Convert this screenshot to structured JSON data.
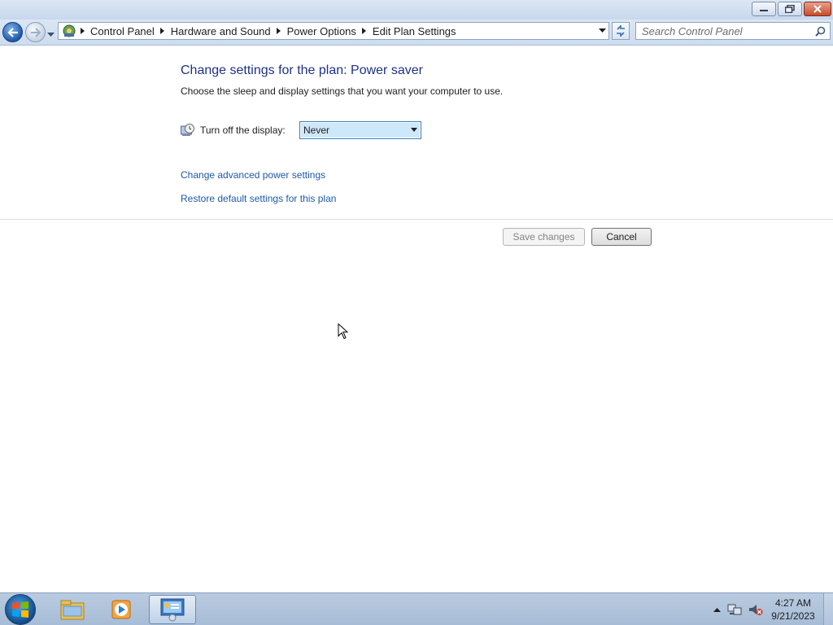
{
  "window": {
    "minimize_icon": "minimize-icon",
    "maximize_icon": "restore-icon",
    "close_icon": "close-icon"
  },
  "navigation": {
    "back_icon": "back-arrow-icon",
    "forward_icon": "forward-arrow-icon",
    "recent_pages_icon": "chevron-down-icon",
    "refresh_icon": "refresh-icon"
  },
  "breadcrumb": {
    "root_icon": "control-panel-icon",
    "items": [
      "Control Panel",
      "Hardware and Sound",
      "Power Options",
      "Edit Plan Settings"
    ]
  },
  "search": {
    "placeholder": "Search Control Panel",
    "icon": "search-icon"
  },
  "main": {
    "heading": "Change settings for the plan: Power saver",
    "subtext": "Choose the sleep and display settings that you want your computer to use.",
    "display_setting": {
      "icon": "monitor-clock-icon",
      "label": "Turn off the display:",
      "value": "Never"
    },
    "links": {
      "advanced": "Change advanced power settings",
      "restore": "Restore default settings for this plan"
    },
    "buttons": {
      "save": "Save changes",
      "cancel": "Cancel"
    }
  },
  "taskbar": {
    "start_icon": "windows-start-icon",
    "items": [
      {
        "icon": "file-explorer-icon"
      },
      {
        "icon": "media-player-icon"
      },
      {
        "icon": "control-panel-icon"
      }
    ],
    "tray": {
      "show_hidden_icon": "chevron-up-icon",
      "network_icon": "network-icon",
      "volume_icon": "volume-muted-icon",
      "time": "4:27 AM",
      "date": "9/21/2023"
    }
  },
  "colors": {
    "heading": "#1e3287",
    "link": "#1e5aa8",
    "select_highlight": "#cde8fb"
  }
}
